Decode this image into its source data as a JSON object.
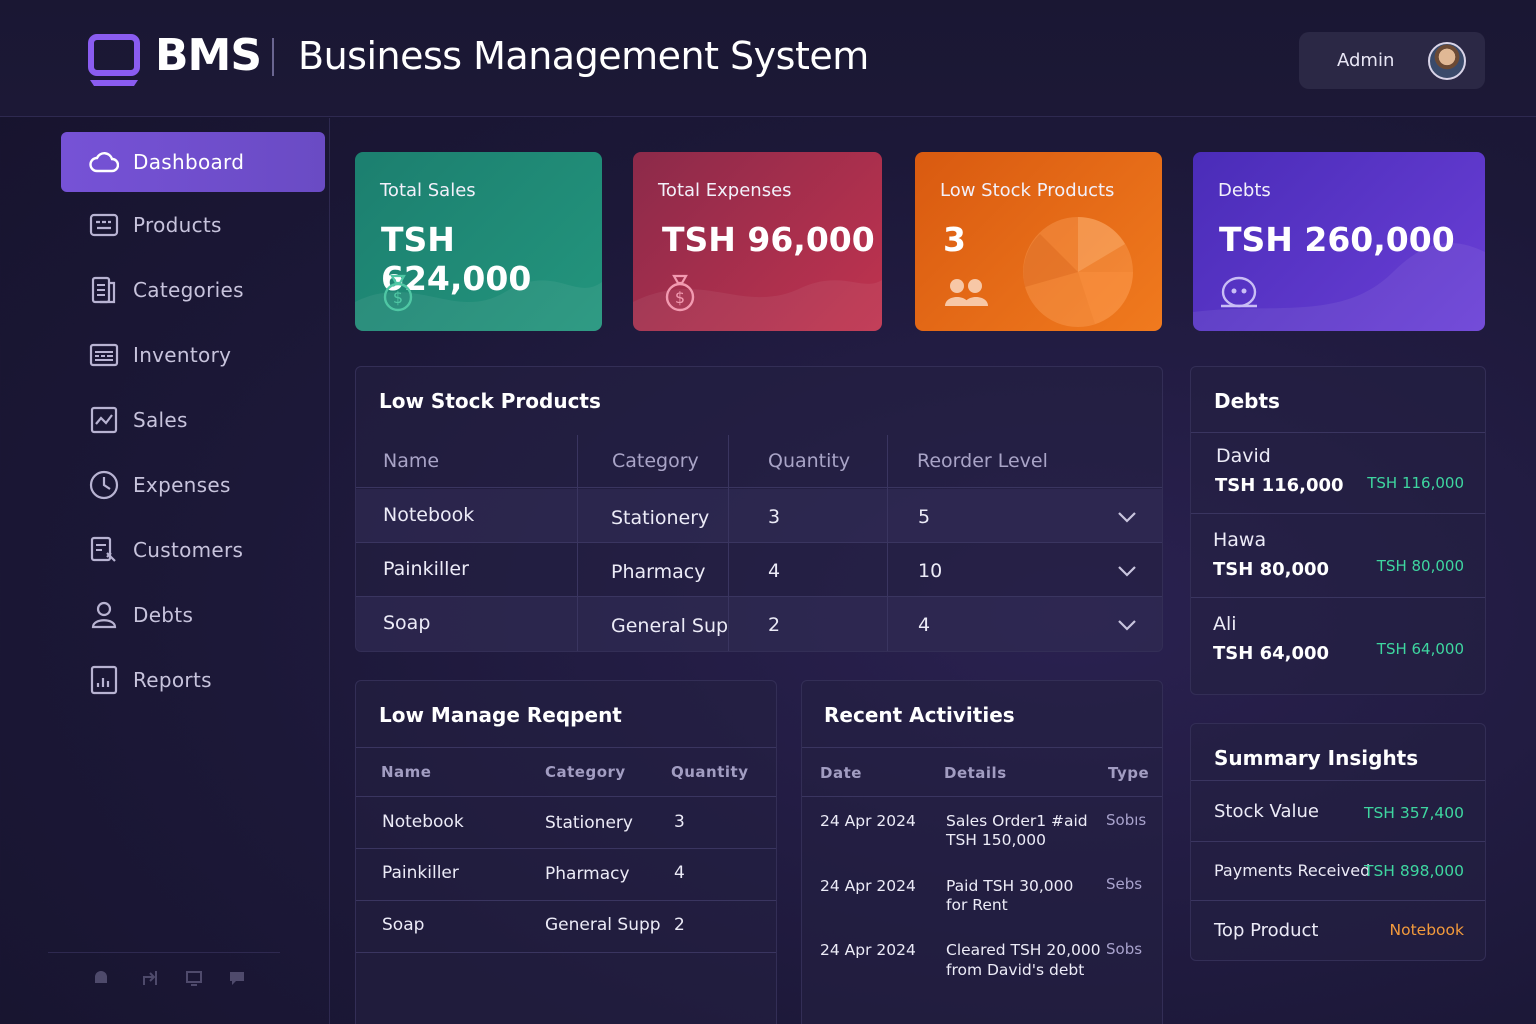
{
  "header": {
    "brand": "BMS",
    "title": "Business Management System",
    "user_label": "Admin"
  },
  "sidebar": {
    "items": [
      {
        "label": "Dashboard",
        "icon": "cloud-icon",
        "active": true
      },
      {
        "label": "Products",
        "icon": "id-card-icon"
      },
      {
        "label": "Categories",
        "icon": "document-icon"
      },
      {
        "label": "Inventory",
        "icon": "keyboard-icon"
      },
      {
        "label": "Sales",
        "icon": "chart-image-icon"
      },
      {
        "label": "Expenses",
        "icon": "clock-icon"
      },
      {
        "label": "Customers",
        "icon": "customer-icon"
      },
      {
        "label": "Debts",
        "icon": "user-icon"
      },
      {
        "label": "Reports",
        "icon": "report-icon"
      }
    ],
    "footer_icons": [
      "bell-icon",
      "share-icon",
      "monitor-icon",
      "chat-icon"
    ]
  },
  "stats": [
    {
      "label": "Total Sales",
      "value": "TSH 624,000",
      "icon": "money-bag-icon",
      "color": "#1f8f78"
    },
    {
      "label": "Total Expenses",
      "value": "TSH 96,000",
      "icon": "money-bag-icon",
      "color": "#b32d4e"
    },
    {
      "label": "Low Stock Products",
      "value": "3",
      "icon": "users-icon",
      "color": "#ee6a12"
    },
    {
      "label": "Debts",
      "value": "TSH 260,000",
      "icon": "chat-face-icon",
      "color": "#5a34c9"
    }
  ],
  "low_stock": {
    "title": "Low Stock Products",
    "columns": [
      "Name",
      "Category",
      "Quantity",
      "Reorder Level"
    ],
    "rows": [
      {
        "name": "Notebook",
        "category": "Stationery",
        "quantity": "3",
        "reorder": "5"
      },
      {
        "name": "Painkiller",
        "category": "Pharmacy",
        "quantity": "4",
        "reorder": "10"
      },
      {
        "name": "Soap",
        "category": "General Supp",
        "quantity": "2",
        "reorder": "4"
      }
    ]
  },
  "low_manage": {
    "title": "Low Manage Reqpent",
    "columns": [
      "Name",
      "Category",
      "Quantity"
    ],
    "rows": [
      {
        "name": "Notebook",
        "category": "Stationery",
        "quantity": "3"
      },
      {
        "name": "Painkiller",
        "category": "Pharmacy",
        "quantity": "4"
      },
      {
        "name": "Soap",
        "category": "General Supp",
        "quantity": "2"
      }
    ]
  },
  "activities": {
    "title": "Recent Activities",
    "columns": [
      "Date",
      "Details",
      "Type"
    ],
    "rows": [
      {
        "date": "24 Apr 2024",
        "details_1": "Sales Order1 #aid",
        "details_2": "TSH 150,000",
        "type": "Sobıs"
      },
      {
        "date": "24 Apr 2024",
        "details_1": "Paid TSH 30,000",
        "details_2": "for Rent",
        "type": "Sebs"
      },
      {
        "date": "24 Apr 2024",
        "details_1": "Cleared TSH 20,000",
        "details_2": "from David's debt",
        "type": "Sobs"
      }
    ]
  },
  "debts": {
    "title": "Debts",
    "items": [
      {
        "name": "David",
        "amount": "TSH 116,000",
        "side": "TSH 116,000"
      },
      {
        "name": "Hawa",
        "amount": "TSH 80,000",
        "side": "TSH 80,000"
      },
      {
        "name": "Ali",
        "amount": "TSH 64,000",
        "side": "TSH 64,000"
      }
    ]
  },
  "insights": {
    "title": "Summary Insights",
    "items": [
      {
        "label": "Stock Value",
        "value": "TSH 357,400",
        "color": "#3ed6a0"
      },
      {
        "label": "Payments Received",
        "value": "TSH 898,000",
        "color": "#3ed6a0"
      },
      {
        "label": "Top Product",
        "value": "Notebook",
        "color": "#f39a3c"
      }
    ]
  }
}
